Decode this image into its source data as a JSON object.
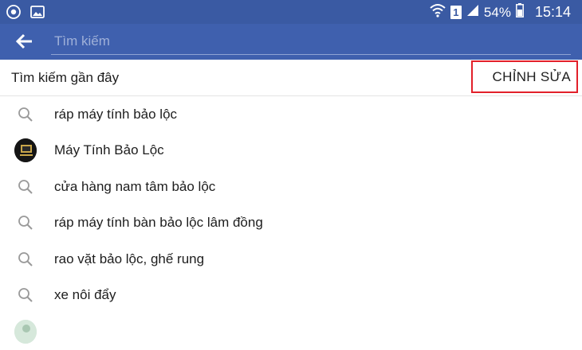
{
  "status_bar": {
    "battery": "54%",
    "time": "15:14",
    "sim_label": "1"
  },
  "app_bar": {
    "search_placeholder": "Tìm kiếm"
  },
  "recent": {
    "title": "Tìm kiếm gần đây",
    "edit_label": "CHỈNH SỬA"
  },
  "items": [
    {
      "icon": "search-icon",
      "label": "ráp máy tính bảo lộc"
    },
    {
      "icon": "avatar",
      "label": "Máy Tính Bảo Lộc"
    },
    {
      "icon": "search-icon",
      "label": "cửa hàng nam tâm bảo lộc"
    },
    {
      "icon": "search-icon",
      "label": "ráp máy tính bàn bảo lộc lâm đồng"
    },
    {
      "icon": "search-icon",
      "label": "rao vặt bảo lộc, ghế rung"
    },
    {
      "icon": "search-icon",
      "label": "xe nôi đẩy"
    },
    {
      "icon": "avatar",
      "label": ""
    }
  ],
  "colors": {
    "status_bar": "#3a5aa3",
    "app_bar": "#3f60ae",
    "highlight": "#e2202a"
  }
}
